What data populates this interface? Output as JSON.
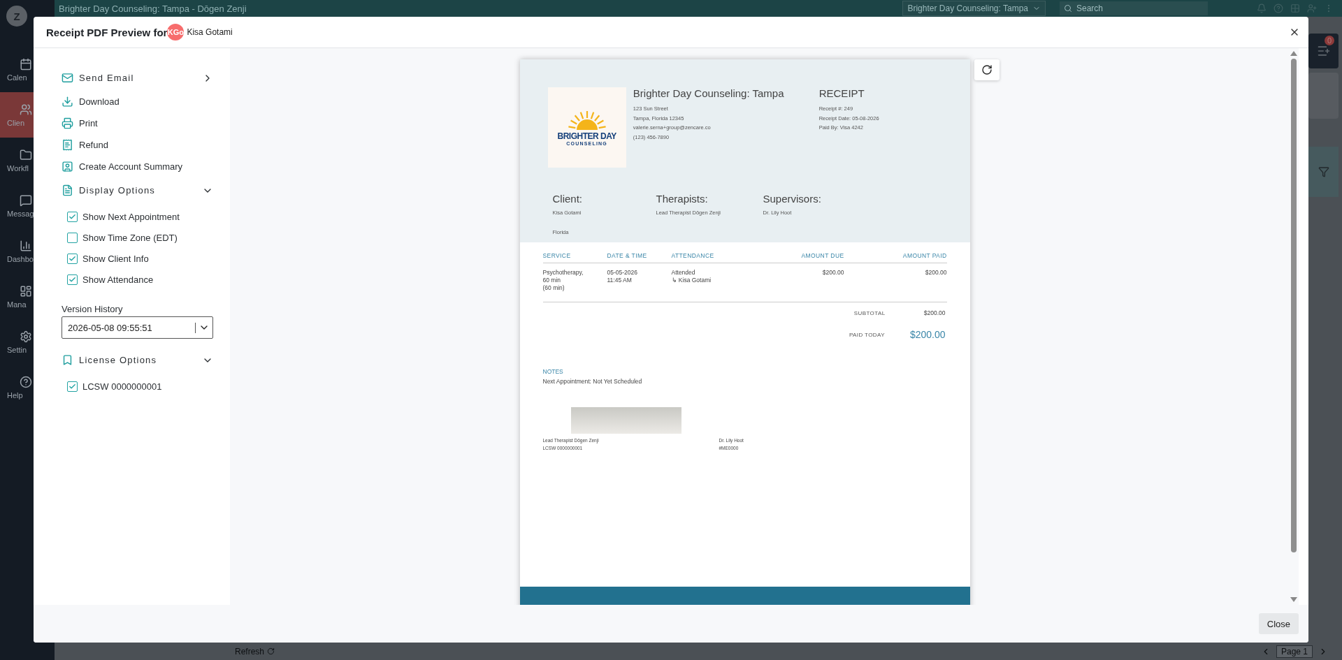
{
  "app": {
    "avatar": "Z",
    "nav": [
      {
        "label": "Calen",
        "selected": false
      },
      {
        "label": "Clien",
        "selected": true
      },
      {
        "label": "Workfl",
        "selected": false
      },
      {
        "label": "Messag",
        "selected": false
      },
      {
        "label": "Dashbo",
        "selected": false
      },
      {
        "label": "Mana",
        "selected": false
      },
      {
        "label": "Settin",
        "selected": false
      },
      {
        "label": "Help",
        "selected": false
      }
    ],
    "title": "Brighter Day Counseling: Tampa - Dōgen Zenji",
    "location": "Brighter Day Counseling: Tampa",
    "search": {
      "placeholder": "Search"
    },
    "queue_badge": "0",
    "refresh": "Refresh",
    "page": "Page 1"
  },
  "modal": {
    "title": "Receipt PDF Preview for",
    "client_initials": "KGo",
    "client_name": "Kisa Gotami",
    "actions": [
      {
        "kind": "submenu",
        "label": "Send Email"
      },
      {
        "kind": "action",
        "label": "Download"
      },
      {
        "kind": "action",
        "label": "Print"
      },
      {
        "kind": "action",
        "label": "Refund"
      },
      {
        "kind": "action",
        "label": "Create Account Summary"
      }
    ],
    "display_options": {
      "label": "Display Options",
      "expanded": true,
      "options": [
        {
          "label": "Show Next Appointment",
          "checked": true
        },
        {
          "label": "Show Time Zone (EDT)",
          "checked": false
        },
        {
          "label": "Show Client Info",
          "checked": true
        },
        {
          "label": "Show Attendance",
          "checked": true
        }
      ]
    },
    "version_history": {
      "label": "Version History",
      "value": "2026-05-08 09:55:51"
    },
    "license_options": {
      "label": "License Options",
      "expanded": true,
      "options": [
        {
          "label": "LCSW 0000000001",
          "checked": true
        }
      ]
    },
    "close": "Close"
  },
  "receipt": {
    "logo": {
      "line1": "BRIGHTER DAY",
      "line2": "COUNSELING"
    },
    "practice": {
      "name": "Brighter Day Counseling: Tampa",
      "lines": [
        "123 Sun Street",
        "Tampa, Florida 12345",
        "valerie.serna+group@zencare.co",
        "(123) 456-7890"
      ]
    },
    "info": {
      "title": "RECEIPT",
      "lines": [
        "Receipt #: 249",
        "Receipt Date: 05-08-2026",
        "Paid By: Visa 4242"
      ]
    },
    "parties": [
      {
        "heading": "Client:",
        "lines": [
          "Kisa Gotami",
          "Florida"
        ]
      },
      {
        "heading": "Therapists:",
        "lines": [
          "Lead Therapist Dōgen Zenji"
        ]
      },
      {
        "heading": "Supervisors:",
        "lines": [
          "Dr. Lily Hoot"
        ]
      }
    ],
    "columns": [
      "SERVICE",
      "DATE & TIME",
      "ATTENDANCE",
      "AMOUNT DUE",
      "AMOUNT PAID"
    ],
    "rows": [
      {
        "cells": [
          [
            "Psychotherapy,",
            "60 min",
            "(60 min)"
          ],
          [
            "05-05-2026",
            "11:45 AM"
          ],
          [
            "Attended",
            "↳ Kisa Gotami"
          ],
          [
            "$200.00"
          ],
          [
            "$200.00"
          ]
        ]
      }
    ],
    "subtotal": {
      "label": "SUBTOTAL",
      "value": "$200.00"
    },
    "paid_today": {
      "label": "PAID TODAY",
      "value": "$200.00"
    },
    "notes": {
      "heading": "NOTES",
      "text": "Next Appointment: Not Yet Scheduled"
    },
    "signers": [
      {
        "lines": [
          "Lead Therapist Dōgen Zenji",
          "LCSW 0000000001"
        ]
      },
      {
        "lines": [
          "Dr. Lily Hoot",
          "#ME0000"
        ]
      }
    ]
  }
}
